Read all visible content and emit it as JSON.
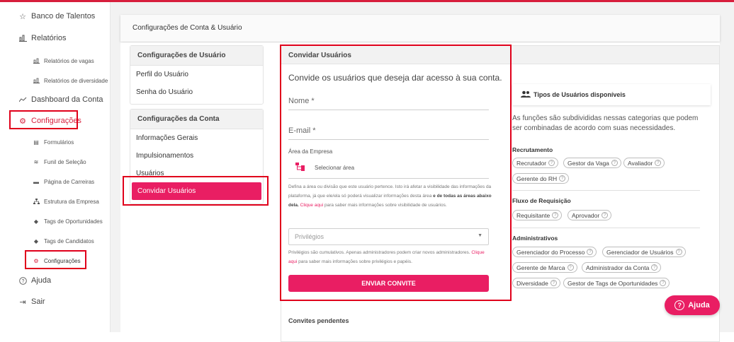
{
  "sidebar": {
    "items": [
      {
        "label": "Banco de Talentos",
        "icon": "star-icon"
      },
      {
        "label": "Relatórios",
        "icon": "bar-chart-icon"
      },
      {
        "label": "Dashboard da Conta",
        "icon": "trend-icon"
      },
      {
        "label": "Configurações",
        "icon": "gear-icon"
      },
      {
        "label": "Ajuda",
        "icon": "help-circle-icon"
      },
      {
        "label": "Sair",
        "icon": "logout-icon"
      }
    ],
    "reports_sub": [
      {
        "label": "Relatórios de vagas"
      },
      {
        "label": "Relatórios de diversidade"
      }
    ],
    "settings_sub": [
      {
        "label": "Formulários"
      },
      {
        "label": "Funil de Seleção"
      },
      {
        "label": "Página de Carreiras"
      },
      {
        "label": "Estrutura da Empresa"
      },
      {
        "label": "Tags de Oportunidades"
      },
      {
        "label": "Tags de Candidatos"
      },
      {
        "label": "Configurações"
      }
    ]
  },
  "header": {
    "title": "Configurações de Conta & Usuário"
  },
  "user_menu": {
    "title": "Configurações de Usuário",
    "links": [
      "Perfil do Usuário",
      "Senha do Usuário"
    ]
  },
  "account_menu": {
    "title": "Configurações da Conta",
    "links": [
      "Informações Gerais",
      "Impulsionamentos",
      "Usuários",
      "Convidar Usuários"
    ]
  },
  "invite": {
    "title": "Convidar Usuários",
    "intro": "Convide os usuários que deseja dar acesso à sua conta.",
    "name_placeholder": "Nome *",
    "email_placeholder": "E-mail *",
    "area_label": "Área da Empresa",
    "area_select": "Selecionar área",
    "area_help_1": "Defina a área ou divisão que este usuário pertence. Isto irá afetar a visibilidade das informações da plataforma, já que ele/ela só poderá visualizar informações desta área ",
    "area_help_bold": "e de todas as áreas abaixo dela.",
    "area_help_link": "Clique aqui",
    "area_help_2": " para saber mais informações sobre visibilidade de usuários.",
    "privileges_placeholder": "Privilégios",
    "priv_help_1": "Privilégios são cumulativos. Apenas administradores podem criar novos administradores.",
    "priv_help_link": "Clique aqui",
    "priv_help_2": " para saber mais informações sobre privilégios e papéis.",
    "send_button": "ENVIAR CONVITE",
    "pending_title": "Convites pendentes"
  },
  "user_types": {
    "title": "Tipos de Usuários disponíveis",
    "description": "As funções são subdivididas nessas categorias que podem ser combinadas de acordo com suas necessidades.",
    "categories": [
      {
        "title": "Recrutamento",
        "chips": [
          "Recrutador",
          "Gestor da Vaga",
          "Avaliador",
          "Gerente do RH"
        ]
      },
      {
        "title": "Fluxo de Requisição",
        "chips": [
          "Requisitante",
          "Aprovador"
        ]
      },
      {
        "title": "Administrativos",
        "chips": [
          "Gerenciador do Processo",
          "Gerenciador de Usuários",
          "Gerente de Marca",
          "Administrador da Conta",
          "Diversidade",
          "Gestor de Tags de Oportunidades"
        ]
      }
    ]
  },
  "help_button": {
    "label": "Ajuda"
  },
  "colors": {
    "accent": "#e91e63",
    "highlight_box": "#e0001b",
    "top_line": "#d71e3c"
  }
}
